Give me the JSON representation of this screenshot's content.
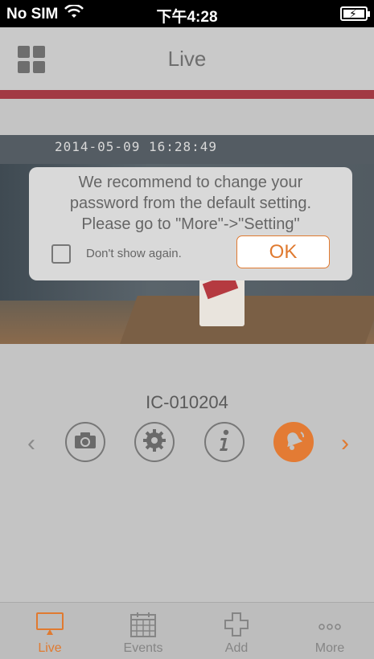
{
  "status_bar": {
    "carrier": "No SIM",
    "time": "下午4:28"
  },
  "nav": {
    "title": "Live"
  },
  "camera": {
    "timestamp": "2014-05-09 16:28:49"
  },
  "alert": {
    "message_lines": [
      "We recommend to change your",
      "password from the default setting.",
      "Please go to \"More\"->\"Setting\""
    ],
    "checkbox_label": "Don't show again.",
    "ok_label": "OK"
  },
  "device": {
    "name": "IC-010204"
  },
  "tabs": [
    {
      "label": "Live",
      "icon": "monitor-icon",
      "active": true
    },
    {
      "label": "Events",
      "icon": "calendar-icon"
    },
    {
      "label": "Add",
      "icon": "plus-icon"
    },
    {
      "label": "More",
      "icon": "more-dots-icon"
    }
  ],
  "colors": {
    "accent": "#e07a30",
    "alert_red_bar": "#a23a44"
  }
}
